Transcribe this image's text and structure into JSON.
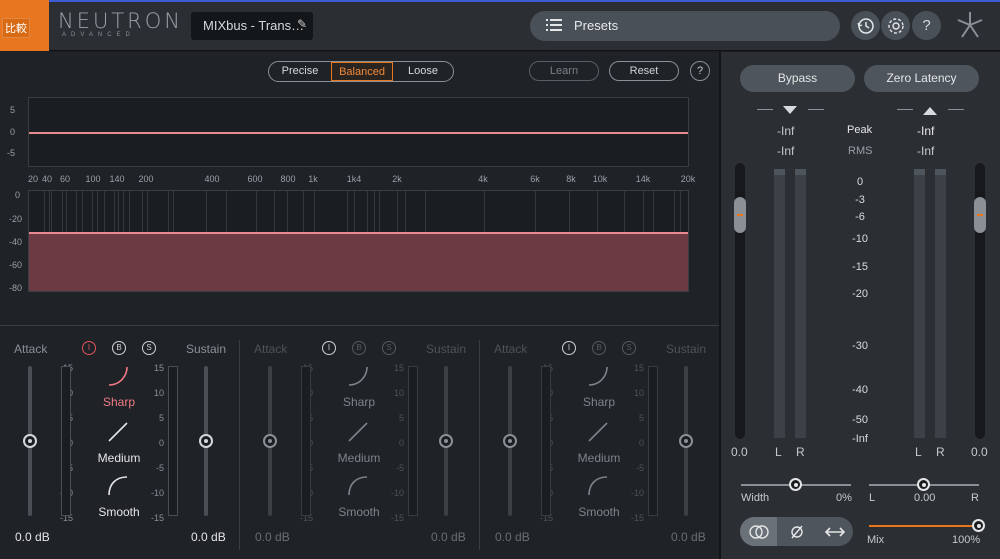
{
  "header": {
    "logo_text": "比較",
    "brand": "NEUTRON",
    "brand_sub": "ADVANCED",
    "preset_name": "MIXbus - Trans…",
    "presets_label": "Presets",
    "help_glyph": "?"
  },
  "controls": {
    "modes": [
      "Precise",
      "Balanced",
      "Loose"
    ],
    "selected_mode": "Balanced",
    "learn": "Learn",
    "reset": "Reset",
    "help": "?"
  },
  "graph": {
    "top_y_ticks": [
      "5",
      "0",
      "-5"
    ],
    "x_ticks": [
      "20",
      "40",
      "60",
      "100",
      "140",
      "200",
      "400",
      "600",
      "800",
      "1k",
      "1k4",
      "2k",
      "4k",
      "6k",
      "8k",
      "10k",
      "14k",
      "20k"
    ],
    "bottom_y_ticks": [
      "0",
      "-20",
      "-40",
      "-60",
      "-80"
    ]
  },
  "bands": [
    {
      "attack": "Attack",
      "sustain": "Sustain",
      "toggles": [
        "I",
        "B",
        "S"
      ],
      "shapes": [
        "Sharp",
        "Medium",
        "Smooth"
      ],
      "selected_shape": "Sharp",
      "attack_db": "0.0 dB",
      "sustain_db": "0.0 dB",
      "active": true
    },
    {
      "attack": "Attack",
      "sustain": "Sustain",
      "toggles": [
        "I",
        "B",
        "S"
      ],
      "shapes": [
        "Sharp",
        "Medium",
        "Smooth"
      ],
      "selected_shape": "",
      "attack_db": "0.0 dB",
      "sustain_db": "0.0 dB",
      "active": false
    },
    {
      "attack": "Attack",
      "sustain": "Sustain",
      "toggles": [
        "I",
        "B",
        "S"
      ],
      "shapes": [
        "Sharp",
        "Medium",
        "Smooth"
      ],
      "selected_shape": "",
      "attack_db": "0.0 dB",
      "sustain_db": "0.0 dB",
      "active": false
    }
  ],
  "scale_ticks": [
    "15",
    "10",
    "5",
    "0",
    "-5",
    "-10",
    "-15"
  ],
  "output": {
    "bypass": "Bypass",
    "zero_latency": "Zero Latency",
    "in_peak": "-Inf",
    "in_rms": "-Inf",
    "out_peak": "-Inf",
    "out_rms": "-Inf",
    "peak_label": "Peak",
    "rms_label": "RMS",
    "db_scale": [
      "0",
      "-3",
      "-6",
      "-10",
      "-15",
      "-20",
      "-30",
      "-40",
      "-50",
      "-Inf"
    ],
    "in_gain": "0.0",
    "out_gain": "0.0",
    "left": "L",
    "right": "R",
    "width_label": "Width",
    "width_value": "0%",
    "pan_left": "L",
    "pan_value": "0.00",
    "pan_right": "R",
    "mix_label": "Mix",
    "mix_value": "100%",
    "mix_level": 1.0,
    "accent": "#e8761e"
  }
}
